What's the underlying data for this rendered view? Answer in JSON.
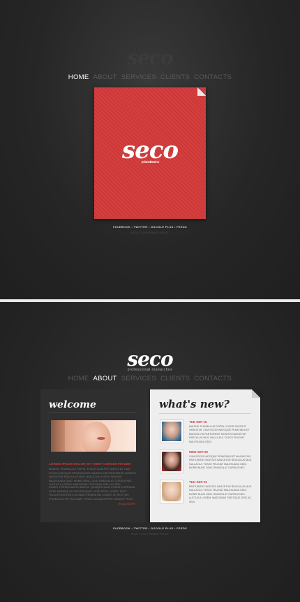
{
  "panel1": {
    "logo": {
      "text": "seco",
      "tagline": "professional researches"
    },
    "nav": [
      "HOME",
      "ABOUT",
      "SERVICES",
      "CLIENTS",
      "CONTACTS"
    ],
    "active_nav": "HOME",
    "card": {
      "logo": "seco",
      "tagline": "professional researches",
      "color": "#d33a3a"
    },
    "footer_links": "FACEBOOK • TWITTER • GOOGLE PLUS • FEEDS",
    "copyright": "SECO © 2012 | PRIVACY POLICY"
  },
  "panel2": {
    "logo": {
      "text": "seco",
      "tagline": "professional researches"
    },
    "nav": [
      "HOME",
      "ABOUT",
      "SERVICES",
      "CLIENTS",
      "CONTACTS"
    ],
    "active_nav": "ABOUT",
    "welcome": {
      "title": "welcome",
      "headline": "LOREM IPSUM DOLOR SIT AMET CONSECTETUER",
      "para1": "MAURIS. PHASELLUS PORTA. FUSCE SUSCIPIT VARIUS MI. CUM SOCIIS NATOQUE PENATIBUS ET MAGNIS DIS PARTURIENT MONTES NASCETUR RIDICULUS MUS. NULLA DUI. FUSCE FEUGIAT MALESUADA ODIO. MORBI NUNC ODIO GRAVIDA AT CURSUS NEC LUCTUS A LOREM. MAECENAS TRISTIQUE ORCI AC SEM.",
      "para2": "DONEC PORTA DIAM EU MASSA. QUISQUE DIAM LOREM INTERDUM VITAE DAPIBUS AC SCELERISQUE VITAE PEDE. DONEC EGET TELLUS NON ERAT LACINIA FERMENTUM. DONEC IN VELIT VEL IPSUM AUCTOR PULVINAR. PROIN ULLAMCORPER URNA ET FELIS.",
      "read_more": "READ MORE"
    },
    "whats_new": {
      "title": "what's new?",
      "items": [
        {
          "date": "TUE SEP 16",
          "text": "MAURIS. PHASELLUS PORTA. FUSCE SUSCIPIT VARIUS MI. CUM SOCIIS NATOQUE PENATIBUS ET MAGNIS DIS PARTURIENT MONTES NASCETUR RIDICULUS MUS. NULLA DUI. FUSCE FEUGIAT MALESUADA ODIO."
        },
        {
          "date": "WED SEP 29",
          "text": "CUM SOCIIS NATOQUE PENATIBUS ET MAGNIS DIS PARTURIENT MONTES NASCETUR RIDICULUS MUS. NULLA DUI. FUSCE FEUGIAT MALESUADA ODIO. MORBI NUNC ODIO GRAVIDA AT CURSUS NEC."
        },
        {
          "date": "THU SEP 23",
          "text": "PARTURIENT MONTES NASCETUR RIDICULUS MUS. NULLA DUI. FUSCE FEUGIAT MALESUADA ODIO. MORBI NUNC ODIO GRAVIDA AT CURSUS NEC LUCTUS A LOREM. MAECENAS TRISTIQUE ORCI AC SEM."
        }
      ]
    },
    "footer_links": "FACEBOOK • TWITTER • GOOGLE PLUS • FEEDS",
    "copyright": "SECO © 2012 | PRIVACY POLICY"
  },
  "colors": {
    "accent": "#d33a3a",
    "background": "#262626",
    "nav_active": "#ffffff",
    "nav_inactive": "#5a5a5a"
  }
}
